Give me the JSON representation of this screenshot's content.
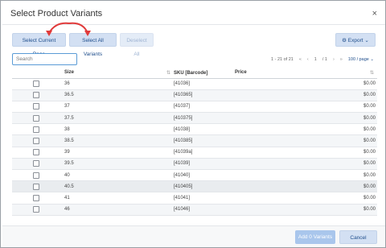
{
  "dialog": {
    "title": "Select Product Variants",
    "close_glyph": "×"
  },
  "toolbar": {
    "select_current_page": "Select Current Page",
    "select_all_variants": "Select All Variants",
    "deselect_all": "Deselect All",
    "export_label": "Export",
    "export_icon": "gear-icon"
  },
  "search": {
    "placeholder": "Search",
    "value": ""
  },
  "pager": {
    "range": "1 - 21 of 21",
    "page": "1",
    "of": "/ 1",
    "per_page": "100 / page"
  },
  "table": {
    "columns": [
      "",
      "Size",
      "SKU [Barcode]",
      "Price"
    ],
    "rows": [
      {
        "size": "36",
        "sku": "[41036]",
        "price": "$0.00"
      },
      {
        "size": "36.5",
        "sku": "[410365]",
        "price": "$0.00"
      },
      {
        "size": "37",
        "sku": "[41037]",
        "price": "$0.00"
      },
      {
        "size": "37.5",
        "sku": "[410375]",
        "price": "$0.00"
      },
      {
        "size": "38",
        "sku": "[41038]",
        "price": "$0.00"
      },
      {
        "size": "38.5",
        "sku": "[410385]",
        "price": "$0.00"
      },
      {
        "size": "39",
        "sku": "[41039a]",
        "price": "$0.00"
      },
      {
        "size": "39.5",
        "sku": "[41039]",
        "price": "$0.00"
      },
      {
        "size": "40",
        "sku": "[41040]",
        "price": "$0.00"
      },
      {
        "size": "40.5",
        "sku": "[410405]",
        "price": "$0.00"
      },
      {
        "size": "41",
        "sku": "[41041]",
        "price": "$0.00"
      },
      {
        "size": "46",
        "sku": "[41046]",
        "price": "$0.00"
      }
    ]
  },
  "footer": {
    "add_label": "Add 0 Variants",
    "cancel_label": "Cancel"
  },
  "colors": {
    "accent": "#1f4e8c",
    "button_bg": "#d3e0f3",
    "annotation_arrow": "#e03a3a"
  }
}
